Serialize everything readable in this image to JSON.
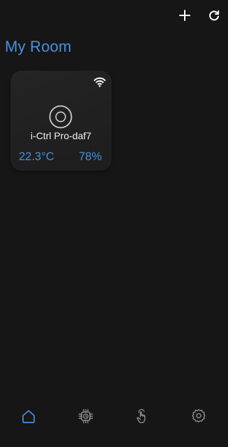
{
  "header": {
    "title": "My Room",
    "actions": [
      {
        "icon": "plus-icon"
      },
      {
        "icon": "refresh-icon"
      }
    ]
  },
  "devices": [
    {
      "name": "i-Ctrl Pro-daf7",
      "temperature": "22.3°C",
      "humidity": "78%",
      "connection_icon": "wifi-icon",
      "device_icon": "device-ring-icon"
    }
  ],
  "bottom_nav": {
    "items": [
      {
        "icon": "home-icon",
        "active": true
      },
      {
        "icon": "chip-icon",
        "active": false
      },
      {
        "icon": "touch-icon",
        "active": false
      },
      {
        "icon": "gear-icon",
        "active": false
      }
    ]
  },
  "colors": {
    "background": "#161616",
    "card": "#222222",
    "accent": "#4a8fe0",
    "icon": "#ffffff",
    "nav_inactive": "#8c8c8c",
    "text": "#f2f2f2"
  }
}
